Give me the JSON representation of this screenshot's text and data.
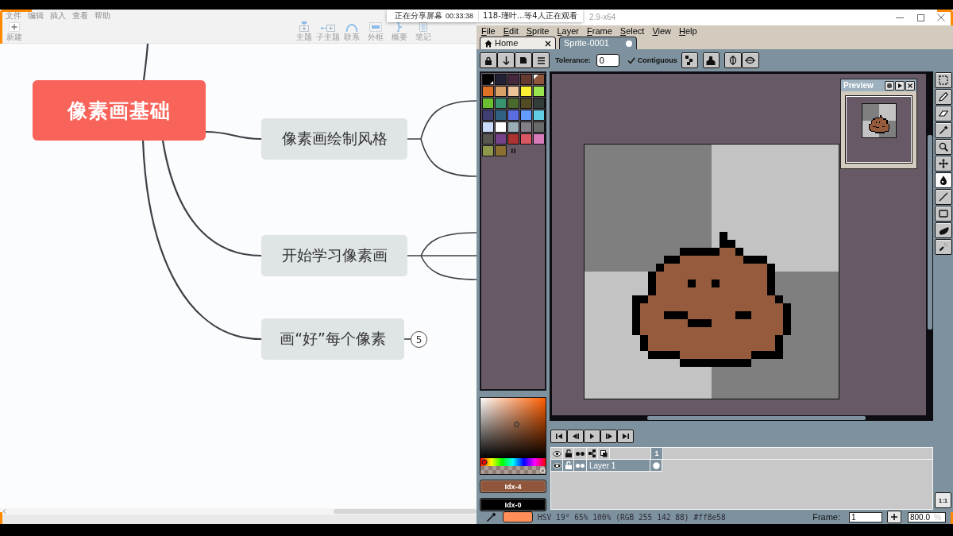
{
  "screen_share": {
    "status": "正在分享屏幕",
    "time": "00:33:38",
    "viewers": "118-瑾叶...等4人正在观看"
  },
  "mindmap": {
    "menu": [
      "文件",
      "编辑",
      "插入",
      "查看",
      "帮助"
    ],
    "new_button": "新建",
    "toolbar": [
      {
        "kind": "topic",
        "label": "主题"
      },
      {
        "kind": "subtopic",
        "label": "子主题"
      },
      {
        "kind": "relationship",
        "label": "联系"
      },
      {
        "kind": "boundary",
        "label": "外框"
      },
      {
        "kind": "summary",
        "label": "概要"
      },
      {
        "kind": "note",
        "label": "笔记"
      }
    ],
    "central_topic": "像素画基础",
    "topics": [
      {
        "label": "像素画绘制风格",
        "kind": "pair"
      },
      {
        "label": "开始学习像素画",
        "kind": "trio"
      },
      {
        "label": "画“好”每个像素",
        "kind": "folded",
        "count": "5"
      }
    ]
  },
  "aseprite": {
    "title": "2.9-x64",
    "menu": [
      "File",
      "Edit",
      "Sprite",
      "Layer",
      "Frame",
      "Select",
      "View",
      "Help"
    ],
    "tabs": [
      {
        "label": "Home",
        "kind": "home",
        "selected": false,
        "modified": false
      },
      {
        "label": "Sprite-0001",
        "kind": "sprite",
        "selected": true,
        "modified": true
      }
    ],
    "tool_options": {
      "tolerance_label": "Tolerance:",
      "tolerance": "0",
      "contiguous": {
        "label": "Contiguous",
        "checked": true
      }
    },
    "palette": [
      {
        "color": "#000000",
        "foreground": false,
        "background": true
      },
      {
        "color": "#222034",
        "foreground": false,
        "background": false
      },
      {
        "color": "#45283c",
        "foreground": false,
        "background": false
      },
      {
        "color": "#663931",
        "foreground": false,
        "background": false
      },
      {
        "color": "#8f563b",
        "foreground": true,
        "background": false
      },
      {
        "color": "#df7126",
        "foreground": false,
        "background": false
      },
      {
        "color": "#d9a066",
        "foreground": false,
        "background": false
      },
      {
        "color": "#eec39a",
        "foreground": false,
        "background": false
      },
      {
        "color": "#fbf236",
        "foreground": false,
        "background": false
      },
      {
        "color": "#99e550",
        "foreground": false,
        "background": false
      },
      {
        "color": "#6abe30",
        "foreground": false,
        "background": false
      },
      {
        "color": "#37946e",
        "foreground": false,
        "background": false
      },
      {
        "color": "#4b692f",
        "foreground": false,
        "background": false
      },
      {
        "color": "#524b24",
        "foreground": false,
        "background": false
      },
      {
        "color": "#323c39",
        "foreground": false,
        "background": false
      },
      {
        "color": "#3f3f74",
        "foreground": false,
        "background": false
      },
      {
        "color": "#306082",
        "foreground": false,
        "background": false
      },
      {
        "color": "#5b6ee1",
        "foreground": false,
        "background": false
      },
      {
        "color": "#639bff",
        "foreground": false,
        "background": false
      },
      {
        "color": "#5fcde4",
        "foreground": false,
        "background": false
      },
      {
        "color": "#cbdbfc",
        "foreground": false,
        "background": false
      },
      {
        "color": "#ffffff",
        "foreground": false,
        "background": false
      },
      {
        "color": "#9badb7",
        "foreground": false,
        "background": false
      },
      {
        "color": "#847e87",
        "foreground": false,
        "background": false
      },
      {
        "color": "#696a6a",
        "foreground": false,
        "background": false
      },
      {
        "color": "#595652",
        "foreground": false,
        "background": false
      },
      {
        "color": "#76428a",
        "foreground": false,
        "background": false
      },
      {
        "color": "#ac3232",
        "foreground": false,
        "background": false
      },
      {
        "color": "#d95763",
        "foreground": false,
        "background": false
      },
      {
        "color": "#d77bba",
        "foreground": false,
        "background": false
      },
      {
        "color": "#8f974a",
        "foreground": false,
        "background": false
      },
      {
        "color": "#8a6f30",
        "foreground": false,
        "background": false
      }
    ],
    "color_buttons": [
      {
        "label": "Idx-4",
        "color": "#8f563b"
      },
      {
        "label": "Idx-0",
        "color": "#000000"
      }
    ],
    "preview": {
      "title": "Preview"
    },
    "tools": [
      {
        "kind": "marquee",
        "selected": false
      },
      {
        "kind": "pencil",
        "selected": false
      },
      {
        "kind": "eraser",
        "selected": false
      },
      {
        "kind": "eyedropper",
        "selected": false
      },
      {
        "kind": "zoom",
        "selected": false
      },
      {
        "kind": "move",
        "selected": false
      },
      {
        "kind": "bucket",
        "selected": true
      },
      {
        "kind": "line",
        "selected": false
      },
      {
        "kind": "rectangle",
        "selected": false
      },
      {
        "kind": "blob",
        "selected": false
      },
      {
        "kind": "spray",
        "selected": false
      }
    ],
    "timeline": {
      "frames": [
        "1"
      ],
      "layers": [
        {
          "name": "Layer 1",
          "selected": true
        }
      ]
    },
    "zoom_button": "1:1",
    "status_bar": {
      "color_info": "HSV 19° 65% 100% (RGB 255 142 88) #ff8e58",
      "frame_label": "Frame:",
      "frame": "1",
      "zoom": "800.0",
      "zoom_unit": "%"
    }
  }
}
